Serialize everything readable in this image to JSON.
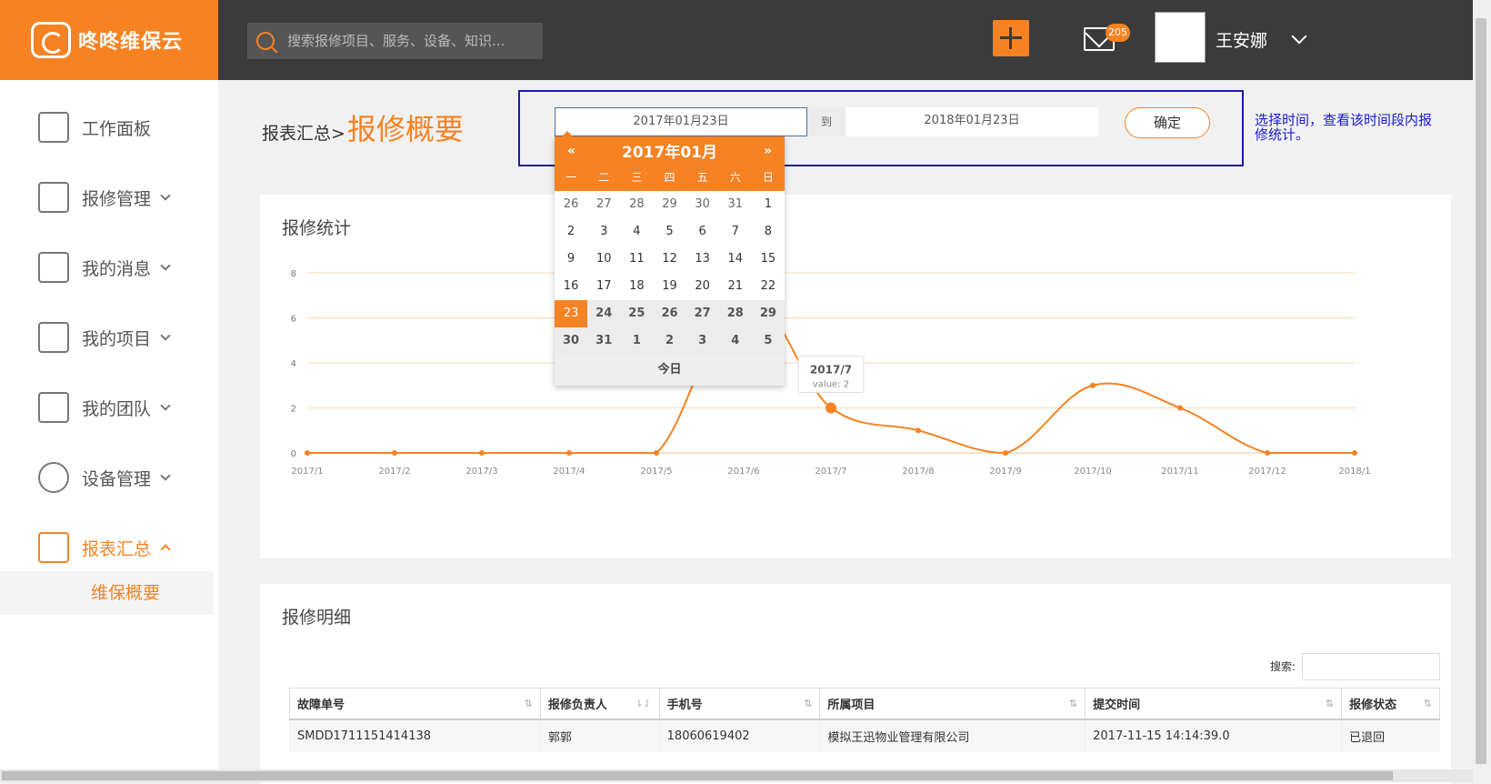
{
  "brand": {
    "name": "咚咚维保云"
  },
  "header": {
    "search_placeholder": "搜索报修项目、服务、设备、知识...",
    "mail_count": "205",
    "user_name": "王安娜"
  },
  "sidebar": {
    "items": [
      {
        "label": "工作面板",
        "icon": "edit-board-icon"
      },
      {
        "label": "报修管理",
        "icon": "tools-icon"
      },
      {
        "label": "我的消息",
        "icon": "envelope-icon"
      },
      {
        "label": "我的项目",
        "icon": "clipboard-icon"
      },
      {
        "label": "我的团队",
        "icon": "building-icon"
      },
      {
        "label": "设备管理",
        "icon": "fan-icon"
      },
      {
        "label": "报表汇总",
        "icon": "chart-icon"
      }
    ],
    "sub_item": "维保概要"
  },
  "breadcrumb": {
    "parent": "报表汇总>",
    "current": "报修概要"
  },
  "date_range": {
    "start": "2017年01月23日",
    "to": "到",
    "end": "2018年01月23日",
    "confirm": "确定",
    "hint": "选择时间，查看该时间段内报修统计。"
  },
  "datepicker": {
    "prev": "«",
    "title": "2017年01月",
    "next": "»",
    "weekdays": [
      "一",
      "二",
      "三",
      "四",
      "五",
      "六",
      "日"
    ],
    "days": [
      [
        "26",
        "27",
        "28",
        "29",
        "30",
        "31",
        "1"
      ],
      [
        "2",
        "3",
        "4",
        "5",
        "6",
        "7",
        "8"
      ],
      [
        "9",
        "10",
        "11",
        "12",
        "13",
        "14",
        "15"
      ],
      [
        "16",
        "17",
        "18",
        "19",
        "20",
        "21",
        "22"
      ],
      [
        "23",
        "24",
        "25",
        "26",
        "27",
        "28",
        "29"
      ],
      [
        "30",
        "31",
        "1",
        "2",
        "3",
        "4",
        "5"
      ]
    ],
    "selected": "23",
    "today": "今日"
  },
  "stats_panel": {
    "title": "报修统计"
  },
  "chart_data": {
    "type": "line",
    "categories": [
      "2017/1",
      "2017/2",
      "2017/3",
      "2017/4",
      "2017/5",
      "2017/6",
      "2017/7",
      "2017/8",
      "2017/9",
      "2017/10",
      "2017/11",
      "2017/12",
      "2018/1"
    ],
    "values": [
      0,
      0,
      0,
      0,
      0,
      7,
      2,
      1,
      0,
      3,
      2,
      0,
      0
    ],
    "yticks": [
      0,
      2,
      4,
      6,
      8
    ],
    "ylim": [
      0,
      8
    ],
    "grid": true,
    "color": "#f78222",
    "tooltip": {
      "label": "2017/7",
      "text": "value: 2"
    }
  },
  "detail_panel": {
    "title": "报修明细",
    "search_label": "搜索:",
    "columns": [
      "故障单号",
      "报修负责人",
      "手机号",
      "所属项目",
      "提交时间",
      "报修状态"
    ],
    "rows": [
      [
        "SMDD1711151414138",
        "郭郭",
        "18060619402",
        "模拟王迅物业管理有限公司",
        "2017-11-15 14:14:39.0",
        "已退回"
      ]
    ]
  }
}
